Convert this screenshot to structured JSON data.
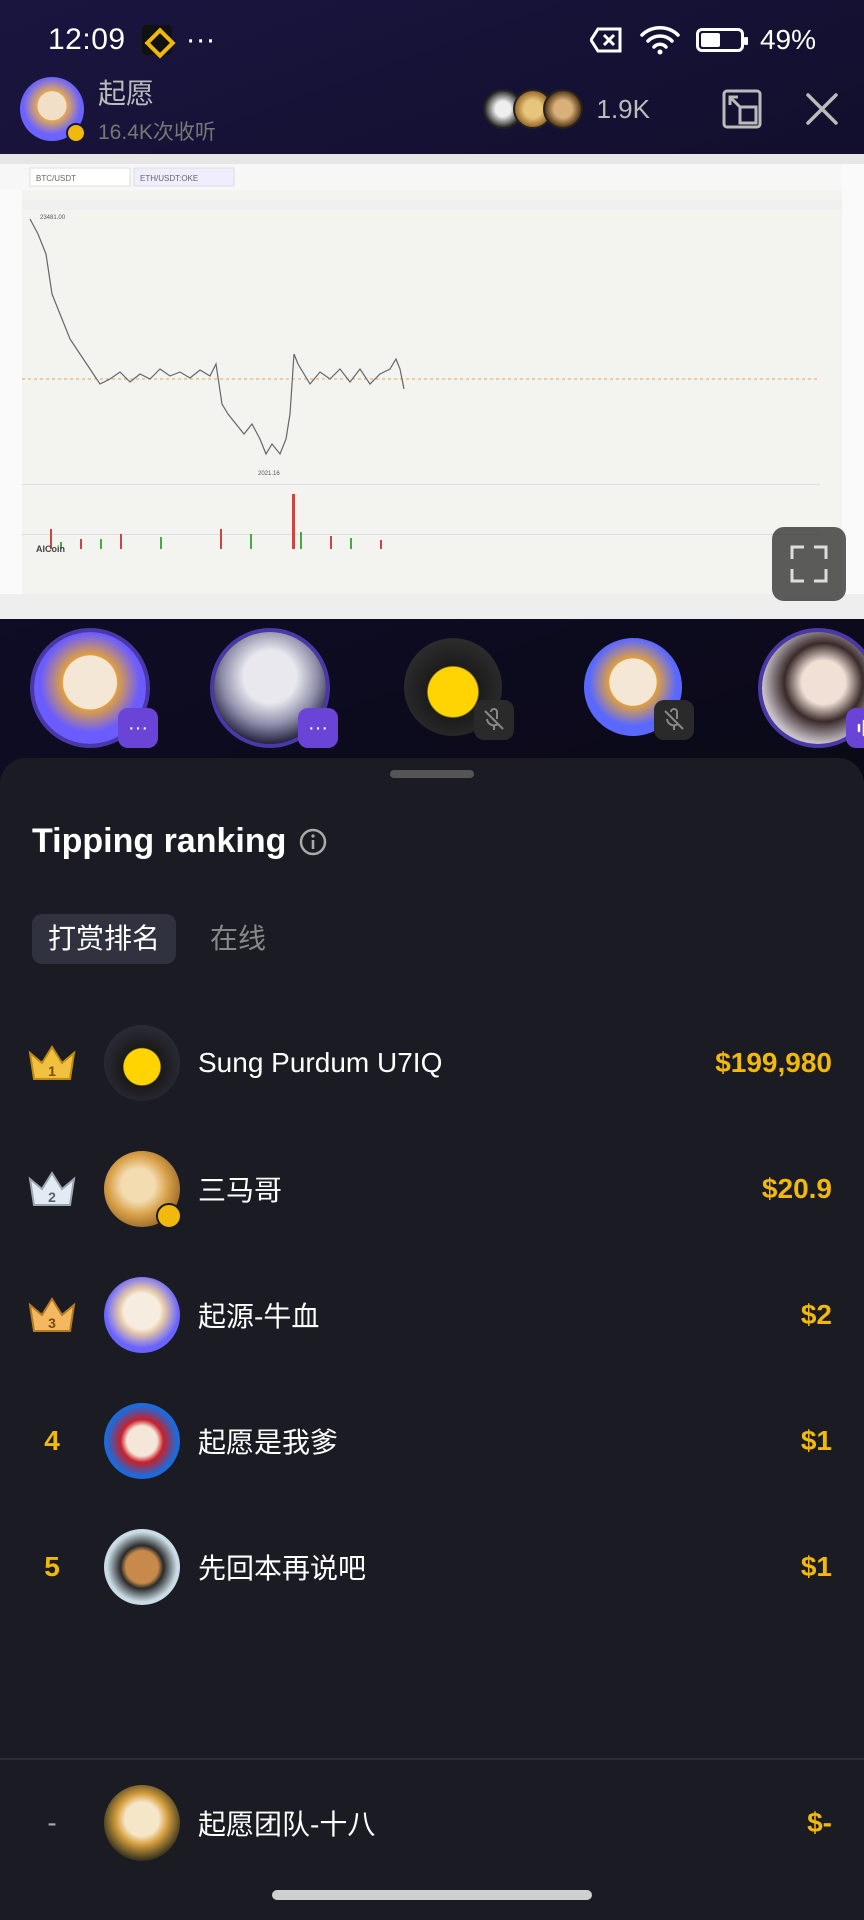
{
  "status_bar": {
    "time": "12:09",
    "more": "···",
    "battery_percent": "49%",
    "battery_level": 0.49,
    "icons": [
      "binance-icon",
      "sim-off-icon",
      "wifi-icon",
      "battery-icon"
    ]
  },
  "header": {
    "host_name": "起愿",
    "listen_count": "16.4K次收听",
    "viewer_count": "1.9K"
  },
  "screen_share": {
    "app": "AICoin",
    "tab_1": "BTC/USDT",
    "tab_2": "ETH/USDT:OKE",
    "price_high_label": "23481.00",
    "price_low_label": "2021.16"
  },
  "speakers": [
    {
      "name": "qiyuan-cow-avatar",
      "status": "more"
    },
    {
      "name": "white-hair-avatar",
      "status": "more"
    },
    {
      "name": "smiley-hat-avatar",
      "status": "muted"
    },
    {
      "name": "cow-avatar-2",
      "status": "muted"
    },
    {
      "name": "girl-avatar",
      "status": "speaking"
    }
  ],
  "sheet": {
    "title": "Tipping ranking",
    "tab_active": "打赏排名",
    "tab_online": "在线"
  },
  "ranking": [
    {
      "rank": "1",
      "name": "Sung Purdum U7IQ",
      "amount": "$199,980"
    },
    {
      "rank": "2",
      "name": "三马哥",
      "amount": "$20.9"
    },
    {
      "rank": "3",
      "name": "起源-牛血",
      "amount": "$2"
    },
    {
      "rank": "4",
      "name": "起愿是我爹",
      "amount": "$1"
    },
    {
      "rank": "5",
      "name": "先回本再说吧",
      "amount": "$1"
    }
  ],
  "me": {
    "rank": "-",
    "name": "起愿团队-十八",
    "amount": "$-"
  },
  "colors": {
    "accent": "#f0b90b",
    "sheet_bg": "#1b1b23",
    "tab_active_bg": "#30323f",
    "purple": "#6a44d6"
  }
}
